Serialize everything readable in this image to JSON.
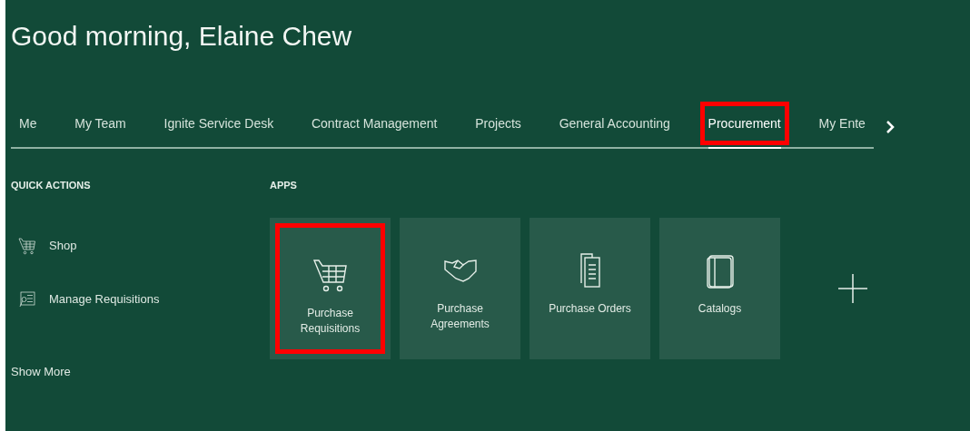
{
  "greeting": "Good morning, Elaine Chew",
  "tabs": [
    {
      "label": "Me",
      "selected": false,
      "highlighted": false
    },
    {
      "label": "My Team",
      "selected": false,
      "highlighted": false
    },
    {
      "label": "Ignite Service Desk",
      "selected": false,
      "highlighted": false
    },
    {
      "label": "Contract Management",
      "selected": false,
      "highlighted": false
    },
    {
      "label": "Projects",
      "selected": false,
      "highlighted": false
    },
    {
      "label": "General Accounting",
      "selected": false,
      "highlighted": false
    },
    {
      "label": "Procurement",
      "selected": true,
      "highlighted": true
    },
    {
      "label": "My Ente",
      "selected": false,
      "highlighted": false
    }
  ],
  "quick_actions": {
    "heading": "QUICK ACTIONS",
    "items": [
      {
        "label": "Shop",
        "kind": "cart"
      },
      {
        "label": "Manage Requisitions",
        "kind": "list"
      }
    ],
    "show_more": "Show More"
  },
  "apps": {
    "heading": "APPS",
    "tiles": [
      {
        "label": "Purchase Requisitions",
        "kind": "cart",
        "highlighted": true
      },
      {
        "label": "Purchase Agreements",
        "kind": "handshake",
        "highlighted": false
      },
      {
        "label": "Purchase Orders",
        "kind": "documents",
        "highlighted": false
      },
      {
        "label": "Catalogs",
        "kind": "book",
        "highlighted": false
      }
    ]
  }
}
